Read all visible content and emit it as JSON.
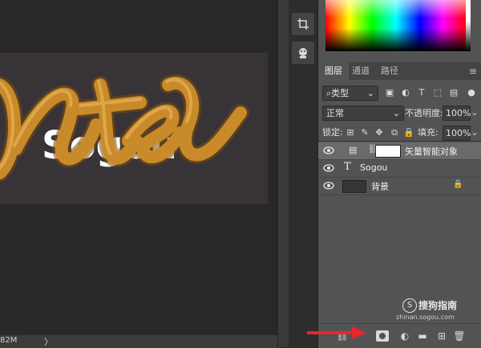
{
  "status_bar": {
    "doc_size": "82M",
    "arrow": "〉"
  },
  "canvas_art": {
    "script_text": "nter",
    "inner_text": "Sogou",
    "stroke_color": "#c98a2a"
  },
  "layers_panel": {
    "tabs": [
      "图层",
      "通道",
      "路径"
    ],
    "menu_icon": "≡",
    "filter": {
      "kind_label": "类型"
    },
    "blend_mode": "正常",
    "opacity_label": "不透明度:",
    "opacity_value": "100%",
    "lock_label": "锁定:",
    "fill_label": "填充:",
    "fill_value": "100%",
    "layers": [
      {
        "name": "矢量智能对象",
        "type": "smart-object",
        "selected": true
      },
      {
        "name": "Sogou",
        "type": "text",
        "selected": false,
        "type_glyph": "T"
      },
      {
        "name": "背景",
        "type": "background",
        "selected": false
      }
    ]
  },
  "watermark": {
    "title": "搜狗指南",
    "url": "zhinan.sogou.com"
  },
  "colors": {
    "accent_orange": "#c98a2a",
    "arrow_red": "#e8262a"
  }
}
